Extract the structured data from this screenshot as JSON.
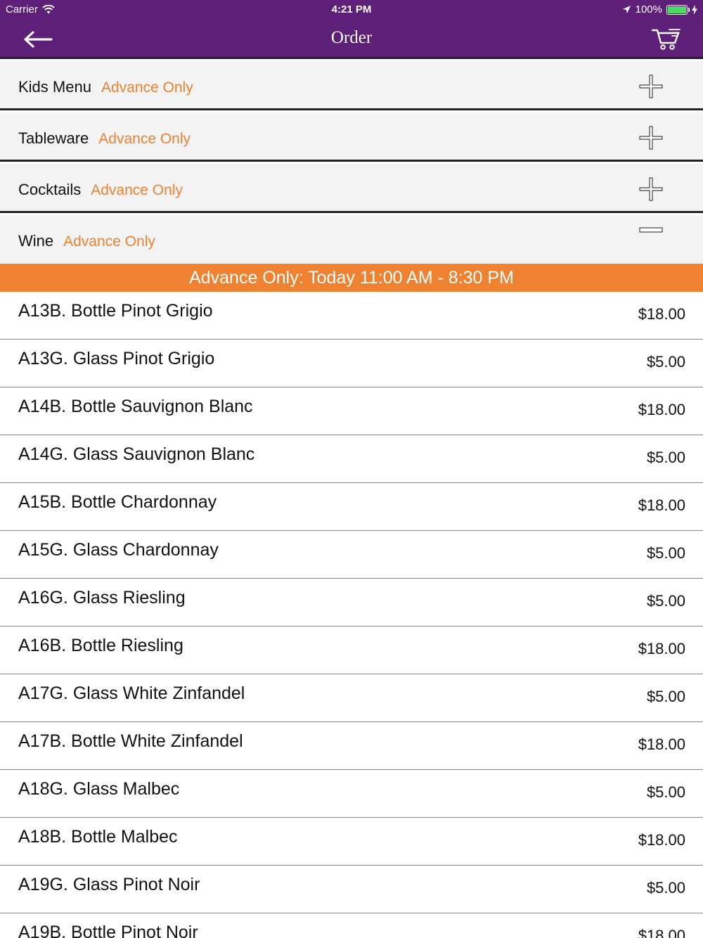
{
  "status_bar": {
    "carrier": "Carrier",
    "time": "4:21 PM",
    "battery": "100%",
    "icons": [
      "wifi-icon",
      "location-arrow-icon",
      "battery-icon",
      "charging-bolt-icon"
    ]
  },
  "nav": {
    "title": "Order",
    "back_icon": "back-arrow-icon",
    "cart_icon": "cart-icon"
  },
  "colors": {
    "brand_purple": "#5e1f78",
    "accent_orange": "#ee8231",
    "category_bg": "#f3f3f3"
  },
  "categories": [
    {
      "name": "Kids Menu",
      "tag": "Advance Only",
      "state": "collapsed"
    },
    {
      "name": "Tableware",
      "tag": "Advance Only",
      "state": "collapsed"
    },
    {
      "name": "Cocktails",
      "tag": "Advance Only",
      "state": "collapsed"
    },
    {
      "name": "Wine",
      "tag": "Advance Only",
      "state": "expanded"
    }
  ],
  "banner": "Advance Only: Today 11:00 AM - 8:30 PM",
  "items": [
    {
      "name": "A13B. Bottle Pinot Grigio",
      "price": "$18.00"
    },
    {
      "name": "A13G. Glass Pinot Grigio",
      "price": "$5.00"
    },
    {
      "name": "A14B. Bottle Sauvignon Blanc",
      "price": "$18.00"
    },
    {
      "name": "A14G. Glass Sauvignon Blanc",
      "price": "$5.00"
    },
    {
      "name": "A15B. Bottle Chardonnay",
      "price": "$18.00"
    },
    {
      "name": "A15G. Glass Chardonnay",
      "price": "$5.00"
    },
    {
      "name": "A16G. Glass Riesling",
      "price": "$5.00"
    },
    {
      "name": "A16B. Bottle Riesling",
      "price": "$18.00"
    },
    {
      "name": "A17G. Glass White Zinfandel",
      "price": "$5.00"
    },
    {
      "name": "A17B. Bottle White Zinfandel",
      "price": "$18.00"
    },
    {
      "name": "A18G. Glass Malbec",
      "price": "$5.00"
    },
    {
      "name": "A18B. Bottle Malbec",
      "price": "$18.00"
    },
    {
      "name": "A19G. Glass Pinot Noir",
      "price": "$5.00"
    },
    {
      "name": "A19B. Bottle Pinot Noir",
      "price": "$18.00"
    }
  ]
}
